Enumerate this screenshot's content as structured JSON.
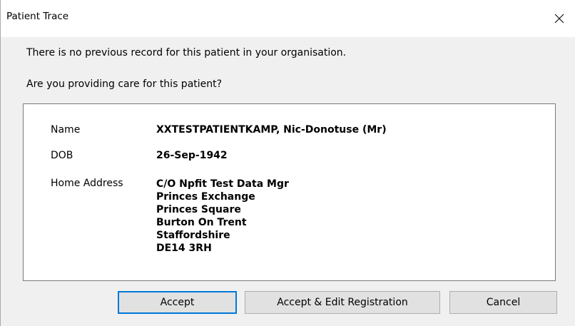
{
  "window": {
    "title": "Patient Trace",
    "close_icon": "close-icon"
  },
  "messages": {
    "no_record": "There is no previous record for this patient in your organisation.",
    "question": "Are you providing care for this patient?"
  },
  "patient": {
    "name_label": "Name",
    "name_value": "XXTESTPATIENTKAMP, Nic-Donotuse (Mr)",
    "dob_label": "DOB",
    "dob_value": "26-Sep-1942",
    "address_label": "Home Address",
    "address_lines": [
      "C/O Npfit Test Data Mgr",
      "Princes Exchange",
      "Princes Square",
      "Burton On Trent",
      "Staffordshire",
      "DE14 3RH"
    ]
  },
  "buttons": {
    "accept": "Accept",
    "accept_edit": "Accept & Edit Registration",
    "cancel": "Cancel"
  },
  "colors": {
    "default_button_border": "#0078d7",
    "dialog_background": "#f0f0f0",
    "info_background": "#ffffff"
  }
}
